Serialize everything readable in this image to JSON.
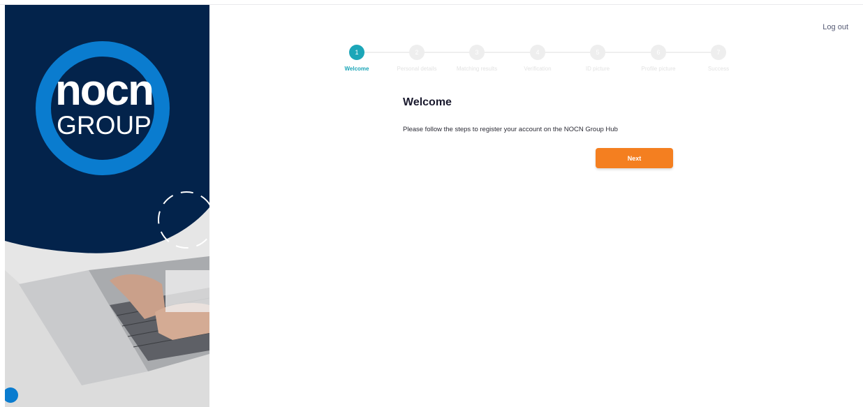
{
  "brand": {
    "logo_word": "nocn",
    "logo_sub": "GROUP",
    "navy": "#03234b",
    "blue": "#0a7ccf"
  },
  "header": {
    "logout_label": "Log out"
  },
  "stepper": {
    "active_index": 0,
    "active_color": "#1ca6b8",
    "steps": [
      {
        "number": "1",
        "label": "Welcome"
      },
      {
        "number": "2",
        "label": "Personal details"
      },
      {
        "number": "3",
        "label": "Matching results"
      },
      {
        "number": "4",
        "label": "Verification"
      },
      {
        "number": "5",
        "label": "ID picture"
      },
      {
        "number": "6",
        "label": "Profile picture"
      },
      {
        "number": "7",
        "label": "Success"
      }
    ]
  },
  "main": {
    "title": "Welcome",
    "body": "Please follow the steps to register your account on the NOCN Group Hub",
    "next_label": "Next",
    "button_color": "#f47f20"
  }
}
